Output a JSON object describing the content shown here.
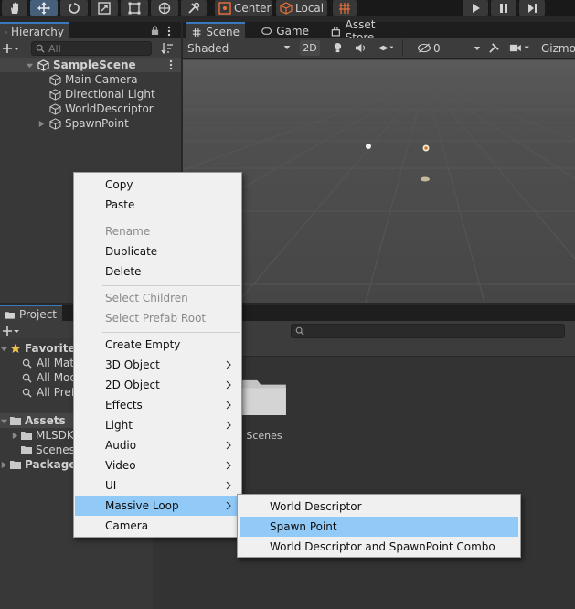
{
  "toolbar": {
    "pivot_label": "Center",
    "space_label": "Local"
  },
  "hierarchy": {
    "tab_label": "Hierarchy",
    "search_placeholder": "All",
    "scene_name": "SampleScene",
    "items": [
      {
        "label": "Main Camera"
      },
      {
        "label": "Directional Light"
      },
      {
        "label": "WorldDescriptor"
      },
      {
        "label": "SpawnPoint"
      }
    ]
  },
  "scene": {
    "tabs": [
      {
        "label": "Scene"
      },
      {
        "label": "Game"
      },
      {
        "label": "Asset Store"
      }
    ],
    "shading_mode": "Shaded",
    "mode_2d": "2D",
    "hidden_count": "0",
    "gizmos_label": "Gizmos"
  },
  "project": {
    "tab_label": "Project",
    "favorites_label": "Favorites",
    "favorites": [
      {
        "label": "All Materials"
      },
      {
        "label": "All Models"
      },
      {
        "label": "All Prefabs"
      }
    ],
    "assets_label": "Assets",
    "assets_children": [
      {
        "label": "MLSDK"
      },
      {
        "label": "Scenes"
      }
    ],
    "packages_label": "Packages",
    "folder_label": "Scenes"
  },
  "context_menu": {
    "copy": "Copy",
    "paste": "Paste",
    "rename": "Rename",
    "duplicate": "Duplicate",
    "delete": "Delete",
    "select_children": "Select Children",
    "select_prefab_root": "Select Prefab Root",
    "create_empty": "Create Empty",
    "object_3d": "3D Object",
    "object_2d": "2D Object",
    "effects": "Effects",
    "light": "Light",
    "audio": "Audio",
    "video": "Video",
    "ui": "UI",
    "massive_loop": "Massive Loop",
    "camera": "Camera"
  },
  "submenu": {
    "items": [
      {
        "label": "World Descriptor"
      },
      {
        "label": "Spawn Point"
      },
      {
        "label": "World Descriptor and SpawnPoint Combo"
      }
    ]
  },
  "colors": {
    "highlight": "#91c9f7",
    "panel": "#383838",
    "selected_tab": "#3a79bb"
  }
}
